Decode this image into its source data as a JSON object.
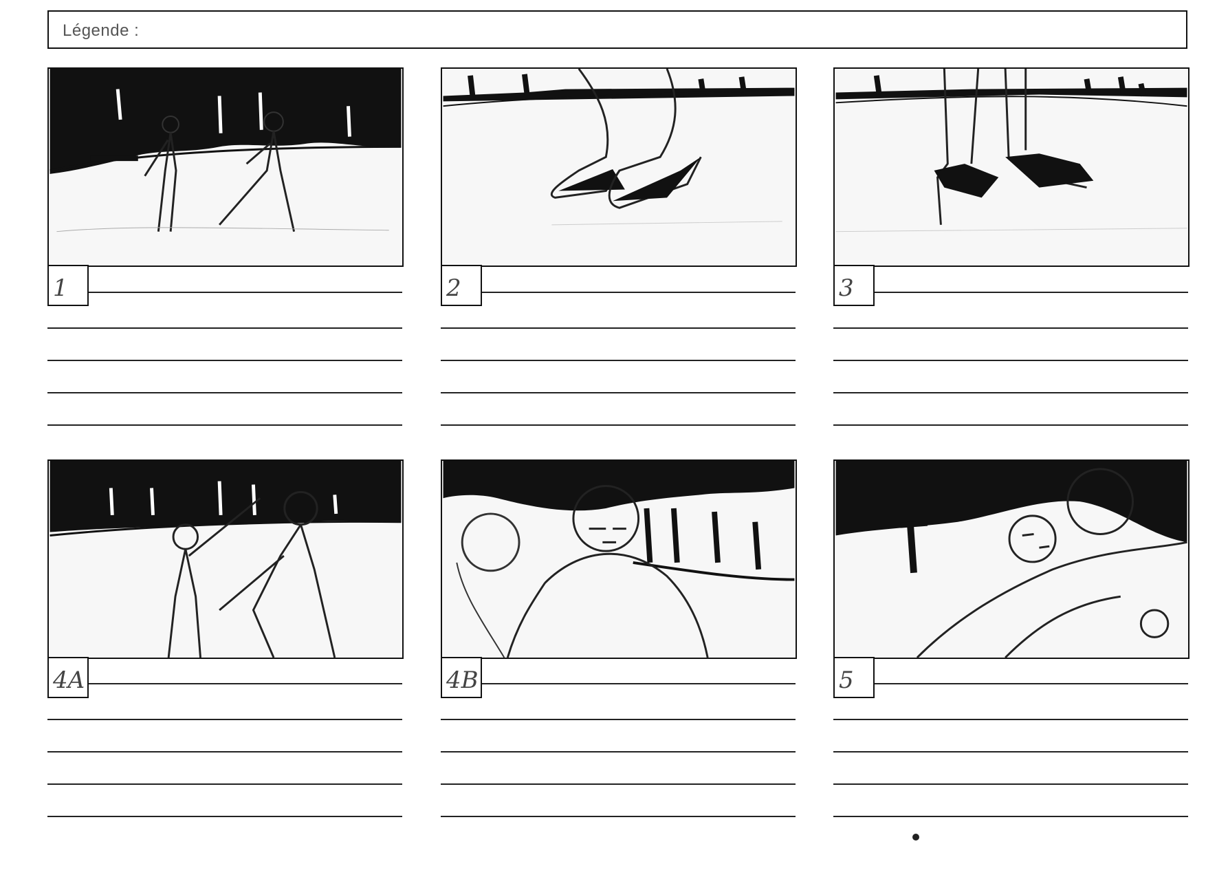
{
  "header": {
    "legend_label": "Légende :"
  },
  "panels": [
    {
      "number": "1"
    },
    {
      "number": "2"
    },
    {
      "number": "3"
    },
    {
      "number": "4A"
    },
    {
      "number": "4B"
    },
    {
      "number": "5"
    }
  ],
  "colors": {
    "ink": "#111111",
    "pencil": "#555555",
    "paper": "#ffffff"
  }
}
